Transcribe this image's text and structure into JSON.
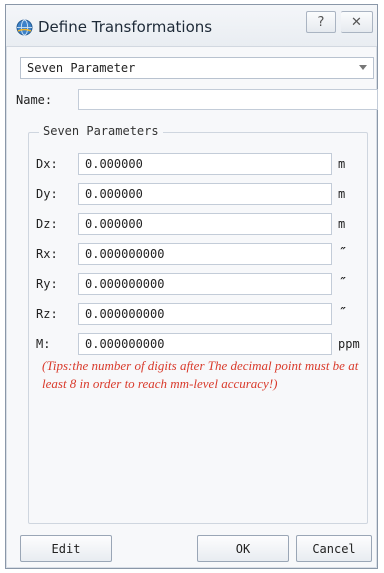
{
  "window": {
    "title": "Define Transformations",
    "help_label": "?",
    "close_label": "✕"
  },
  "method_select": {
    "value": "Seven Parameter"
  },
  "name": {
    "label": "Name:",
    "value": ""
  },
  "group": {
    "title": "Seven Parameters",
    "rows": [
      {
        "label": "Dx:",
        "value": "0.000000",
        "unit": "m"
      },
      {
        "label": "Dy:",
        "value": "0.000000",
        "unit": "m"
      },
      {
        "label": "Dz:",
        "value": "0.000000",
        "unit": "m"
      },
      {
        "label": "Rx:",
        "value": "0.000000000",
        "unit": "″"
      },
      {
        "label": "Ry:",
        "value": "0.000000000",
        "unit": "″"
      },
      {
        "label": "Rz:",
        "value": "0.000000000",
        "unit": "″"
      },
      {
        "label": "M:",
        "value": "0.000000000",
        "unit": "ppm"
      }
    ],
    "tips": "(Tips:the number of digits after The decimal point must be at least 8 in order to reach mm-level accuracy!)"
  },
  "buttons": {
    "edit": "Edit",
    "ok": "OK",
    "cancel": "Cancel"
  }
}
